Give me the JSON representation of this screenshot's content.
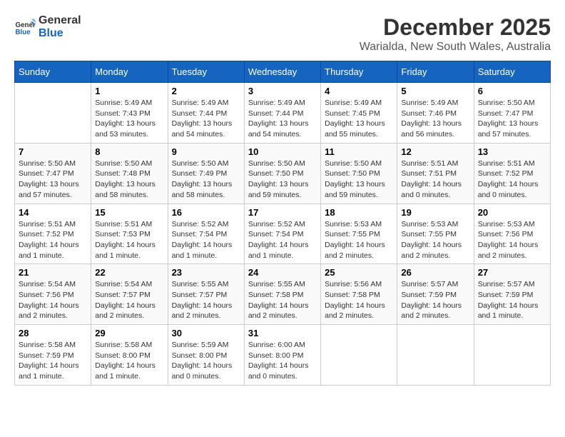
{
  "logo": {
    "line1": "General",
    "line2": "Blue"
  },
  "title": "December 2025",
  "location": "Warialda, New South Wales, Australia",
  "days_of_week": [
    "Sunday",
    "Monday",
    "Tuesday",
    "Wednesday",
    "Thursday",
    "Friday",
    "Saturday"
  ],
  "weeks": [
    [
      {
        "day": "",
        "content": ""
      },
      {
        "day": "1",
        "content": "Sunrise: 5:49 AM\nSunset: 7:43 PM\nDaylight: 13 hours\nand 53 minutes."
      },
      {
        "day": "2",
        "content": "Sunrise: 5:49 AM\nSunset: 7:44 PM\nDaylight: 13 hours\nand 54 minutes."
      },
      {
        "day": "3",
        "content": "Sunrise: 5:49 AM\nSunset: 7:44 PM\nDaylight: 13 hours\nand 54 minutes."
      },
      {
        "day": "4",
        "content": "Sunrise: 5:49 AM\nSunset: 7:45 PM\nDaylight: 13 hours\nand 55 minutes."
      },
      {
        "day": "5",
        "content": "Sunrise: 5:49 AM\nSunset: 7:46 PM\nDaylight: 13 hours\nand 56 minutes."
      },
      {
        "day": "6",
        "content": "Sunrise: 5:50 AM\nSunset: 7:47 PM\nDaylight: 13 hours\nand 57 minutes."
      }
    ],
    [
      {
        "day": "7",
        "content": "Sunrise: 5:50 AM\nSunset: 7:47 PM\nDaylight: 13 hours\nand 57 minutes."
      },
      {
        "day": "8",
        "content": "Sunrise: 5:50 AM\nSunset: 7:48 PM\nDaylight: 13 hours\nand 58 minutes."
      },
      {
        "day": "9",
        "content": "Sunrise: 5:50 AM\nSunset: 7:49 PM\nDaylight: 13 hours\nand 58 minutes."
      },
      {
        "day": "10",
        "content": "Sunrise: 5:50 AM\nSunset: 7:50 PM\nDaylight: 13 hours\nand 59 minutes."
      },
      {
        "day": "11",
        "content": "Sunrise: 5:50 AM\nSunset: 7:50 PM\nDaylight: 13 hours\nand 59 minutes."
      },
      {
        "day": "12",
        "content": "Sunrise: 5:51 AM\nSunset: 7:51 PM\nDaylight: 14 hours\nand 0 minutes."
      },
      {
        "day": "13",
        "content": "Sunrise: 5:51 AM\nSunset: 7:52 PM\nDaylight: 14 hours\nand 0 minutes."
      }
    ],
    [
      {
        "day": "14",
        "content": "Sunrise: 5:51 AM\nSunset: 7:52 PM\nDaylight: 14 hours\nand 1 minute."
      },
      {
        "day": "15",
        "content": "Sunrise: 5:51 AM\nSunset: 7:53 PM\nDaylight: 14 hours\nand 1 minute."
      },
      {
        "day": "16",
        "content": "Sunrise: 5:52 AM\nSunset: 7:54 PM\nDaylight: 14 hours\nand 1 minute."
      },
      {
        "day": "17",
        "content": "Sunrise: 5:52 AM\nSunset: 7:54 PM\nDaylight: 14 hours\nand 1 minute."
      },
      {
        "day": "18",
        "content": "Sunrise: 5:53 AM\nSunset: 7:55 PM\nDaylight: 14 hours\nand 2 minutes."
      },
      {
        "day": "19",
        "content": "Sunrise: 5:53 AM\nSunset: 7:55 PM\nDaylight: 14 hours\nand 2 minutes."
      },
      {
        "day": "20",
        "content": "Sunrise: 5:53 AM\nSunset: 7:56 PM\nDaylight: 14 hours\nand 2 minutes."
      }
    ],
    [
      {
        "day": "21",
        "content": "Sunrise: 5:54 AM\nSunset: 7:56 PM\nDaylight: 14 hours\nand 2 minutes."
      },
      {
        "day": "22",
        "content": "Sunrise: 5:54 AM\nSunset: 7:57 PM\nDaylight: 14 hours\nand 2 minutes."
      },
      {
        "day": "23",
        "content": "Sunrise: 5:55 AM\nSunset: 7:57 PM\nDaylight: 14 hours\nand 2 minutes."
      },
      {
        "day": "24",
        "content": "Sunrise: 5:55 AM\nSunset: 7:58 PM\nDaylight: 14 hours\nand 2 minutes."
      },
      {
        "day": "25",
        "content": "Sunrise: 5:56 AM\nSunset: 7:58 PM\nDaylight: 14 hours\nand 2 minutes."
      },
      {
        "day": "26",
        "content": "Sunrise: 5:57 AM\nSunset: 7:59 PM\nDaylight: 14 hours\nand 2 minutes."
      },
      {
        "day": "27",
        "content": "Sunrise: 5:57 AM\nSunset: 7:59 PM\nDaylight: 14 hours\nand 1 minute."
      }
    ],
    [
      {
        "day": "28",
        "content": "Sunrise: 5:58 AM\nSunset: 7:59 PM\nDaylight: 14 hours\nand 1 minute."
      },
      {
        "day": "29",
        "content": "Sunrise: 5:58 AM\nSunset: 8:00 PM\nDaylight: 14 hours\nand 1 minute."
      },
      {
        "day": "30",
        "content": "Sunrise: 5:59 AM\nSunset: 8:00 PM\nDaylight: 14 hours\nand 0 minutes."
      },
      {
        "day": "31",
        "content": "Sunrise: 6:00 AM\nSunset: 8:00 PM\nDaylight: 14 hours\nand 0 minutes."
      },
      {
        "day": "",
        "content": ""
      },
      {
        "day": "",
        "content": ""
      },
      {
        "day": "",
        "content": ""
      }
    ]
  ]
}
